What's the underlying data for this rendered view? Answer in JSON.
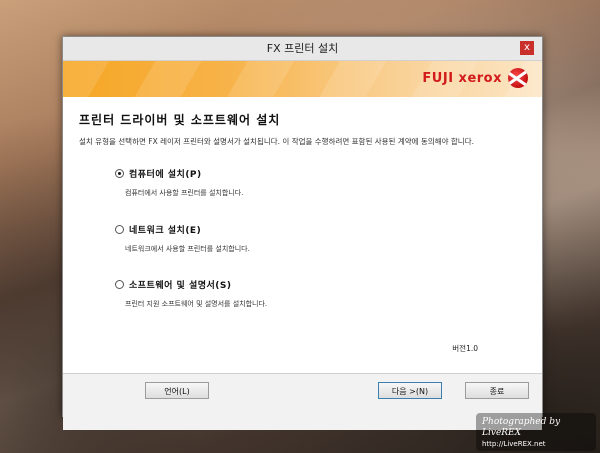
{
  "window": {
    "title": "FX 프린터 설치",
    "close_glyph": "x"
  },
  "banner": {
    "logo_text": "FUJI xerox"
  },
  "main": {
    "heading": "프린터 드라이버 및 소프트웨어 설치",
    "description": "설치 유형을 선택하면 FX 레이저 프린터와 설명서가 설치됩니다. 이 작업을 수행하려면 표함된 사용된 계약에 동의해야 합니다.",
    "options": [
      {
        "label": "컴퓨터에 설치(P)",
        "sub": "컴퓨터에서 사용할 프린터를 설치합니다.",
        "checked": true
      },
      {
        "label": "네트워크 설치(E)",
        "sub": "네트워크에서 사용할 프린터를 설치합니다.",
        "checked": false
      },
      {
        "label": "소프트웨어 및 설명서(S)",
        "sub": "프린터 지원 소프트웨어 및 설명서를 설치합니다.",
        "checked": false
      }
    ],
    "version": "버전1.0"
  },
  "footer": {
    "language_label": "언어(L)",
    "next_label": "다음 >(N)",
    "exit_label": "종료"
  },
  "watermark": {
    "line1": "Photographed by LiveREX",
    "line2": "http://LiveREX.net"
  }
}
